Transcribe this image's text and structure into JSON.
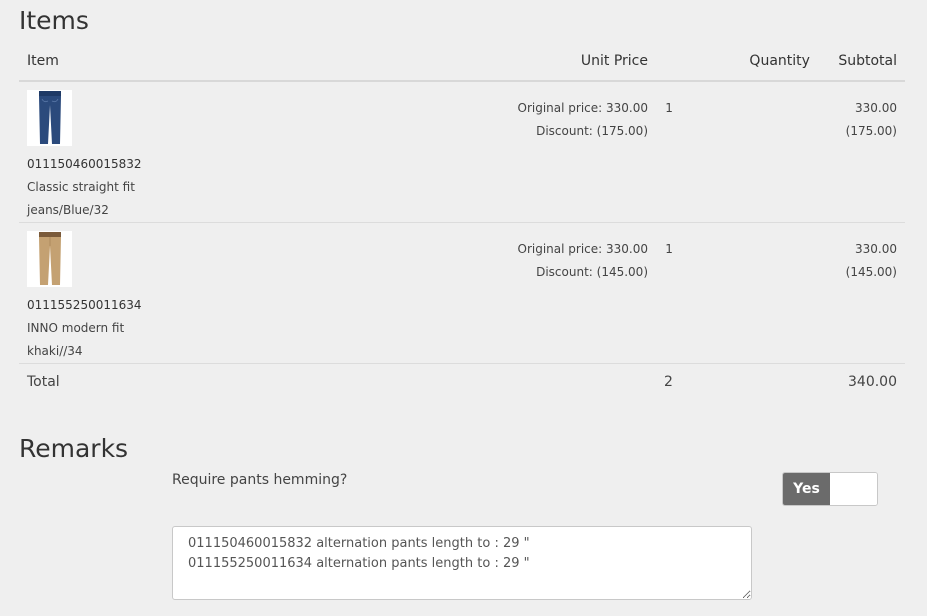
{
  "items_section": {
    "title": "Items",
    "columns": {
      "item": "Item",
      "unit_price": "Unit Price",
      "quantity": "Quantity",
      "subtotal": "Subtotal"
    },
    "rows": [
      {
        "image_icon": "jeans-icon",
        "sku": "011150460015832",
        "description": "Classic straight fit jeans/Blue/32",
        "original_price": "Original price: 330.00",
        "discount": "Discount: (175.00)",
        "quantity": "1",
        "subtotal": "330.00",
        "subtotal_discount": "(175.00)"
      },
      {
        "image_icon": "khaki-pants-icon",
        "sku": "011155250011634",
        "description": "INNO modern fit khaki//34",
        "original_price": "Original price: 330.00",
        "discount": "Discount: (145.00)",
        "quantity": "1",
        "subtotal": "330.00",
        "subtotal_discount": "(145.00)"
      }
    ],
    "total": {
      "label": "Total",
      "quantity": "2",
      "amount": "340.00"
    }
  },
  "remarks_section": {
    "title": "Remarks",
    "hemming_question": "Require pants hemming?",
    "toggle": {
      "on_label": "Yes",
      "state": "on"
    },
    "remarks_text": "011150460015832 alternation pants length to : 29 \"\n011155250011634 alternation pants length to : 29 \""
  },
  "colors": {
    "background": "#efefef",
    "jeans": "#2b4a7c",
    "khaki": "#c4a172",
    "toggle_on": "#6b6b6b"
  }
}
